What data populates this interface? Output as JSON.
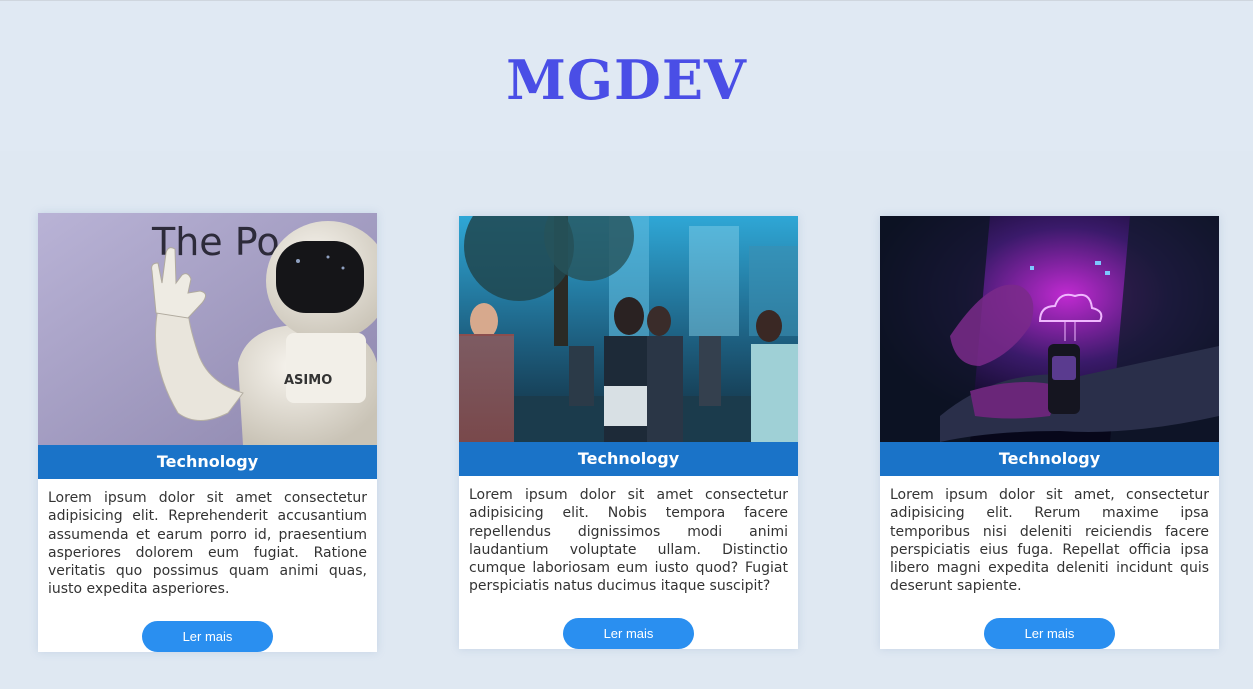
{
  "header": {
    "title": "MGDEV"
  },
  "cards": [
    {
      "category": "Technology",
      "image": "asimo-robot-image",
      "image_text": "The Po",
      "robot_text": "ASIMO",
      "text": "Lorem ipsum dolor sit amet consectetur adipisicing elit. Reprehenderit accusantium assumenda et earum porro id, praesentium asperiores dolorem eum fugiat. Ratione veritatis quo possimus quam animi quas, iusto expedita asperiores.",
      "button_label": "Ler mais"
    },
    {
      "category": "Technology",
      "image": "city-people-phones-image",
      "text": "Lorem ipsum dolor sit amet consectetur adipisicing elit. Nobis tempora facere repellendus dignissimos modi animi laudantium voluptate ullam. Distinctio cumque laboriosam eum iusto quod? Fugiat perspiciatis natus ducimus itaque suscipit?",
      "button_label": "Ler mais"
    },
    {
      "category": "Technology",
      "image": "smartwatch-cloud-hologram-image",
      "text": "Lorem ipsum dolor sit amet, consectetur adipisicing elit. Rerum maxime ipsa temporibus nisi deleniti reiciendis facere perspiciatis eius fuga. Repellat officia ipsa libero magni expedita deleniti incidunt quis deserunt sapiente.",
      "button_label": "Ler mais"
    }
  ],
  "colors": {
    "background": "#dfe8f2",
    "title": "#4a4ee6",
    "label_bar": "#1a73c8",
    "button": "#2a8ff0"
  }
}
